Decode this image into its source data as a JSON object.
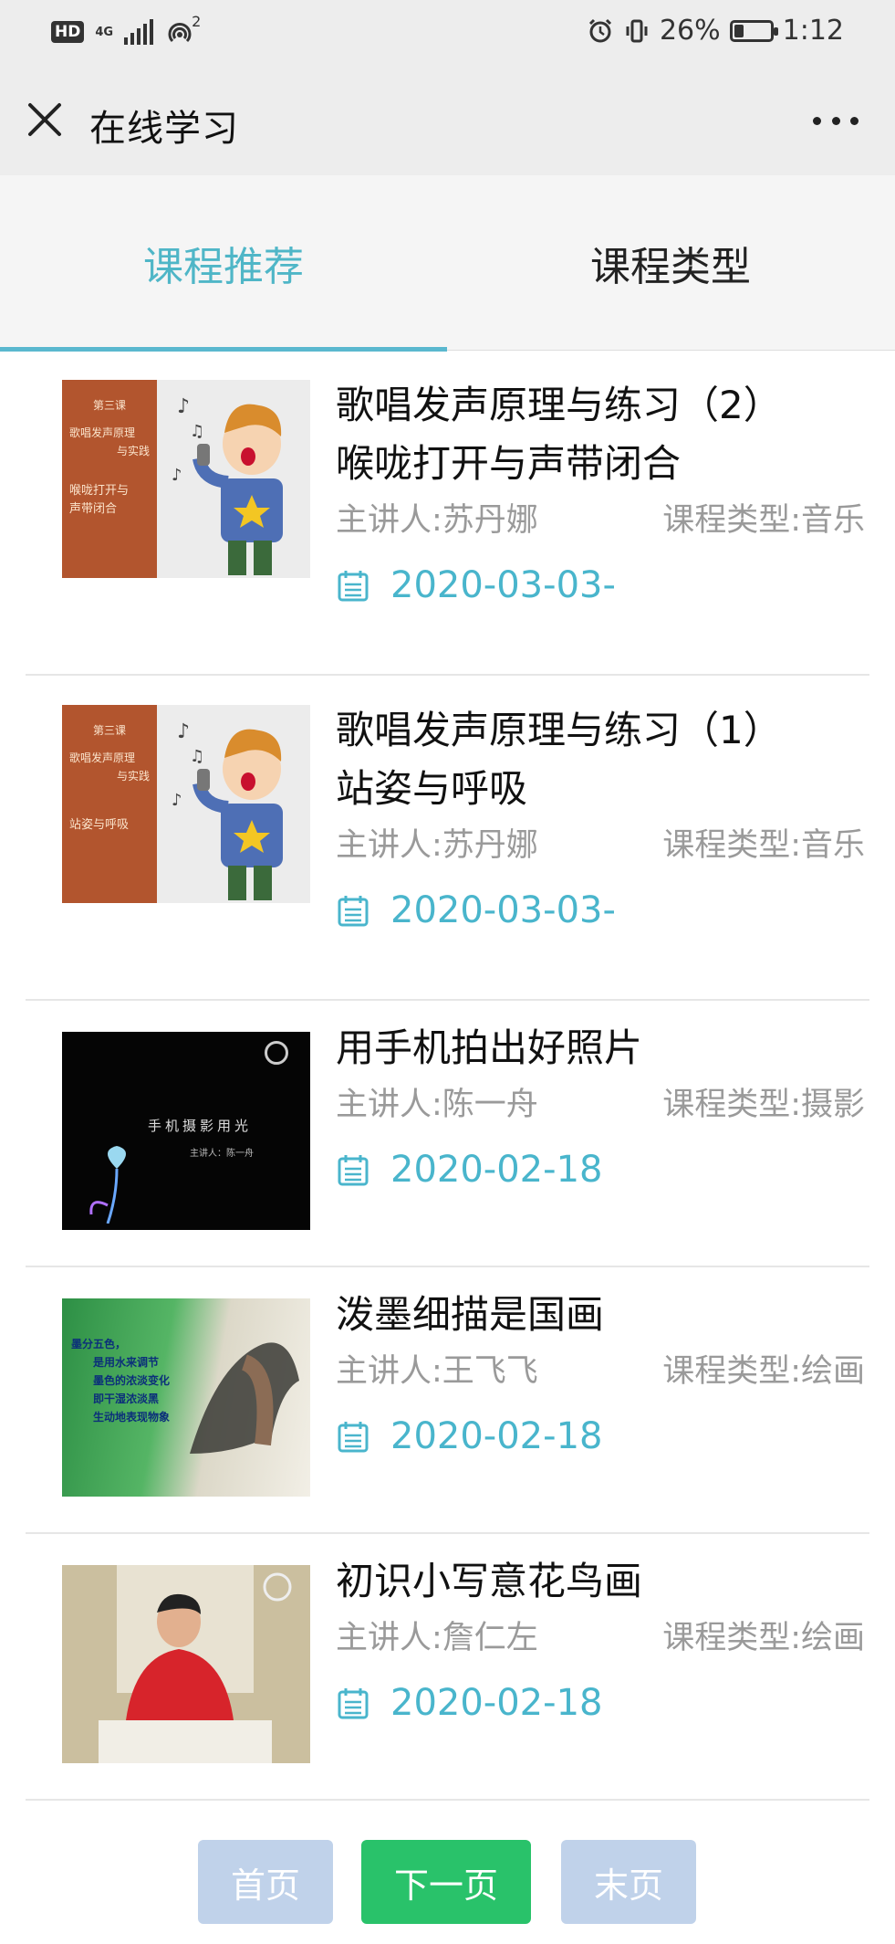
{
  "statusbar": {
    "network_badge": "HD",
    "network_type": "4G",
    "hotspot_count": "2",
    "battery": "26%",
    "battery_level": 0.26,
    "time": "1:12"
  },
  "navbar": {
    "title": "在线学习"
  },
  "tabs": [
    {
      "label": "课程推荐",
      "active": true
    },
    {
      "label": "课程类型",
      "active": false
    }
  ],
  "courses": [
    {
      "title_line1": "歌唱发声原理与练习（2）",
      "title_line2": "喉咙打开与声带闭合",
      "lecturer": "主讲人:苏丹娜",
      "category": "课程类型:音乐",
      "date": "2020-03-03-",
      "thumb_text": [
        "第三课",
        "歌唱发声原理",
        "与实践",
        "喉咙打开与",
        "声带闭合"
      ]
    },
    {
      "title_line1": "歌唱发声原理与练习（1）",
      "title_line2": "站姿与呼吸",
      "lecturer": "主讲人:苏丹娜",
      "category": "课程类型:音乐",
      "date": "2020-03-03-",
      "thumb_text": [
        "第三课",
        "歌唱发声原理",
        "与实践",
        "站姿与呼吸"
      ]
    },
    {
      "title_line1": "用手机拍出好照片",
      "lecturer": "主讲人:陈一舟",
      "category": "课程类型:摄影",
      "date": "2020-02-18",
      "thumb_text": [
        "手机摄影用光",
        "主讲人：陈一舟"
      ]
    },
    {
      "title_line1": "泼墨细描是国画",
      "lecturer": "主讲人:王飞飞",
      "category": "课程类型:绘画",
      "date": "2020-02-18",
      "thumb_text": [
        "墨分五色，",
        "是用水来调节",
        "墨色的浓淡变化",
        "即干湿浓淡黑",
        "生动地表现物象"
      ]
    },
    {
      "title_line1": "初识小写意花鸟画",
      "lecturer": "主讲人:詹仁左",
      "category": "课程类型:绘画",
      "date": "2020-02-18"
    }
  ],
  "pager": {
    "first": "首页",
    "next": "下一页",
    "last": "末页"
  },
  "colors": {
    "accent": "#4fb6c7",
    "next_button": "#29c26a",
    "disabled_button": "#c0d2ea"
  }
}
